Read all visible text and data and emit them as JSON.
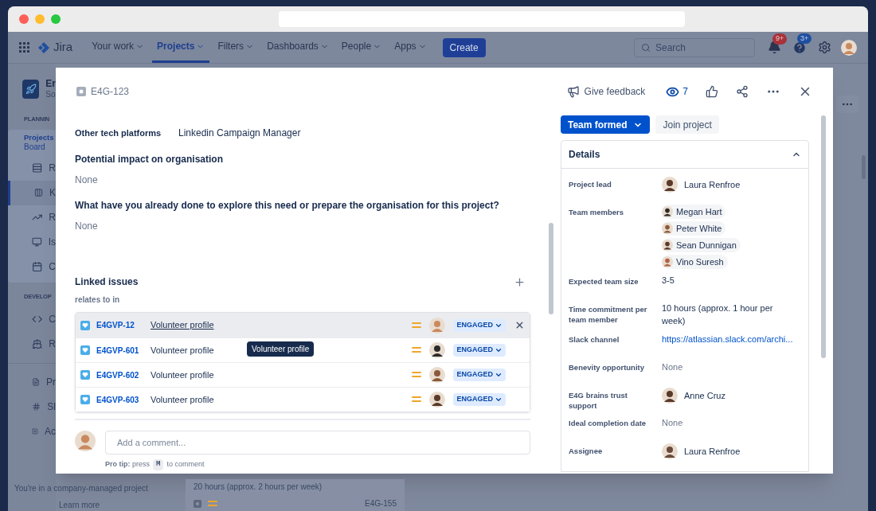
{
  "nav": {
    "product": "Jira",
    "items": [
      {
        "label": "Your work",
        "selected": false
      },
      {
        "label": "Projects",
        "selected": true
      },
      {
        "label": "Filters",
        "selected": false
      },
      {
        "label": "Dashboards",
        "selected": false
      },
      {
        "label": "People",
        "selected": false
      },
      {
        "label": "Apps",
        "selected": false
      }
    ],
    "create": "Create",
    "search_placeholder": "Search",
    "notification_badge": "9+",
    "help_badge": "3+"
  },
  "sidebar": {
    "project_name": "Er",
    "project_sub": "So",
    "groups": [
      {
        "heading": "PLANNIN",
        "items": [
          {
            "label": "Projects",
            "sub": "Board",
            "kind": "header"
          },
          {
            "label": "R",
            "kind": "roadmap",
            "selected": false
          },
          {
            "label": "K",
            "kind": "board",
            "selected": true
          },
          {
            "label": "R",
            "kind": "reports",
            "selected": false
          },
          {
            "label": "Is",
            "kind": "issues",
            "selected": false
          },
          {
            "label": "C",
            "kind": "components",
            "selected": false
          }
        ]
      },
      {
        "heading": "DEVELOP",
        "items": [
          {
            "label": "C",
            "kind": "code",
            "selected": false
          },
          {
            "label": "R",
            "kind": "releases",
            "selected": false
          }
        ]
      },
      {
        "items": [
          {
            "label": "Pr",
            "kind": "pages",
            "selected": false
          },
          {
            "label": "Sl",
            "kind": "slack",
            "selected": false
          },
          {
            "label": "Ac",
            "kind": "add",
            "selected": false
          }
        ]
      }
    ],
    "footer": "You're in a company-managed project",
    "learn_more": "Learn more"
  },
  "background_card": {
    "text": "20 hours (approx. 2 hours per week)",
    "key": "E4G-155"
  },
  "modal": {
    "issue_key": "E4G-123",
    "feedback": "Give feedback",
    "watchers": "7",
    "inline_field": {
      "label": "Other tech platforms",
      "value": "Linkedin Campaign Manager"
    },
    "sections": [
      {
        "heading": "Potential impact on organisation",
        "value": "None"
      },
      {
        "heading": "What have you already done to explore this need or prepare the organisation for this project?",
        "value": "None"
      }
    ],
    "linked_issues": {
      "title": "Linked issues",
      "relation": "relates to in",
      "rows": [
        {
          "key": "E4GVP-12",
          "summary": "Volunteer profile",
          "status": "ENGAGED",
          "hovered": true
        },
        {
          "key": "E4GVP-601",
          "summary": "Volunteer profile",
          "status": "ENGAGED",
          "hovered": false
        },
        {
          "key": "E4GVP-602",
          "summary": "Volunteer profile",
          "status": "ENGAGED",
          "hovered": false
        },
        {
          "key": "E4GVP-603",
          "summary": "Volunteer profile",
          "status": "ENGAGED",
          "hovered": false
        }
      ],
      "tooltip": "Volunteer profile"
    },
    "comment": {
      "placeholder": "Add a comment...",
      "tip": "**Pro tip:** press",
      "key": "M",
      "tip_end": "to comment"
    },
    "status": "Team formed",
    "join": "Join project",
    "details": {
      "title": "Details",
      "expanded": true,
      "fields": [
        {
          "label": "Project lead",
          "kind": "person",
          "values": [
            "Laura Renfroe"
          ]
        },
        {
          "label": "Team members",
          "kind": "people",
          "values": [
            "Megan Hart",
            "Peter White",
            "Sean Dunnigan",
            "Vino Suresh"
          ]
        },
        {
          "label": "Expected team size",
          "kind": "text",
          "values": [
            "3-5"
          ]
        },
        {
          "label": "Time commitment per team member",
          "kind": "text",
          "values": [
            "10 hours (approx. 1 hour per week)"
          ]
        },
        {
          "label": "Slack channel",
          "kind": "link",
          "values": [
            "https://atlassian.slack.com/archi..."
          ]
        },
        {
          "label": "Benevity opportunity",
          "kind": "none",
          "values": [
            "None"
          ]
        },
        {
          "label": "E4G brains trust support",
          "kind": "person",
          "values": [
            "Anne Cruz"
          ]
        },
        {
          "label": "Ideal completion date",
          "kind": "none",
          "values": [
            "None"
          ]
        },
        {
          "label": "Assignee",
          "kind": "person",
          "values": [
            "Laura Renfroe"
          ]
        }
      ]
    }
  }
}
